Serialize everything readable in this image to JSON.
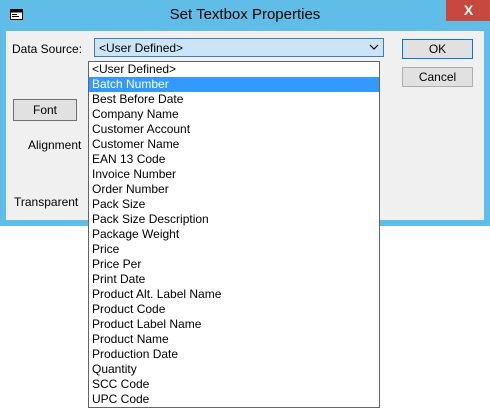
{
  "window": {
    "title": "Set Textbox Properties",
    "close_glyph": "X",
    "title_bar_color": "#5fbde8",
    "close_color": "#c7483e"
  },
  "form": {
    "data_source_label": "Data Source:",
    "data_source_value": "<User Defined>",
    "font_button": "Font",
    "alignment_label": "Alignment",
    "transparent_label": "Transparent"
  },
  "buttons": {
    "ok": "OK",
    "cancel": "Cancel"
  },
  "dropdown": {
    "selected_index": 1,
    "selected_color": "#3399ff",
    "items": [
      "<User Defined>",
      "Batch Number",
      "Best Before Date",
      "Company Name",
      "Customer Account",
      "Customer Name",
      "EAN 13 Code",
      "Invoice Number",
      "Order Number",
      "Pack Size",
      "Pack Size Description",
      "Package Weight",
      "Price",
      "Price Per",
      "Print Date",
      "Product Alt. Label Name",
      "Product Code",
      "Product Label Name",
      "Product Name",
      "Production Date",
      "Quantity",
      "SCC Code",
      "UPC Code"
    ]
  }
}
